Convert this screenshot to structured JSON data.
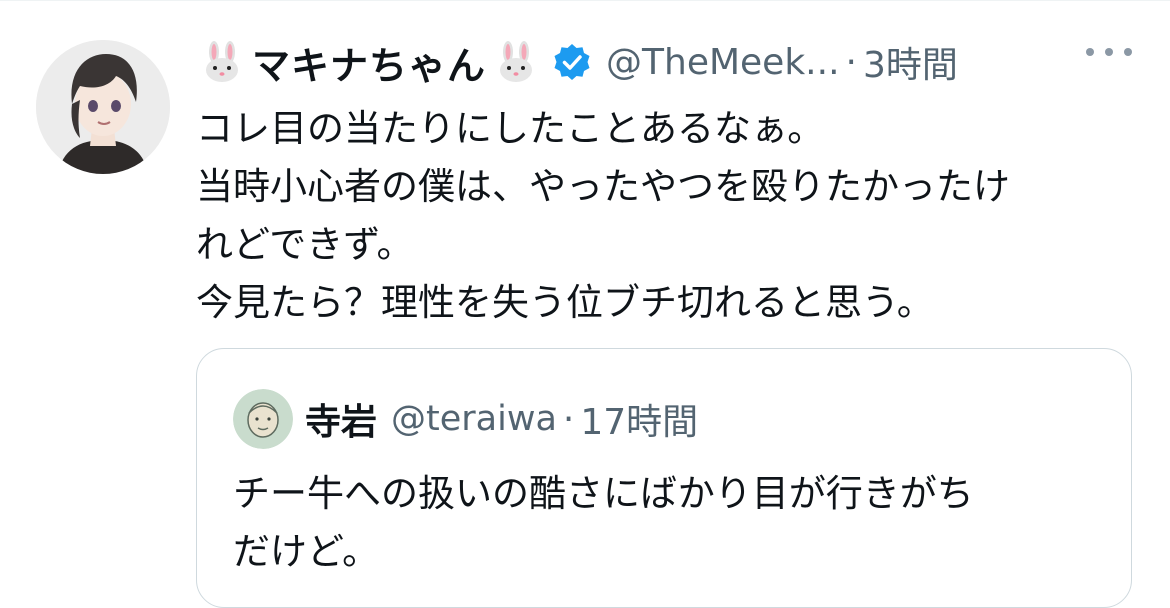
{
  "tweet": {
    "display_name": "マキナちゃん",
    "name_emoji_left": "rabbit-face-emoji",
    "name_emoji_right": "rabbit-face-emoji",
    "verified_icon": "verified-badge-icon",
    "handle": "@TheMeek...",
    "separator": "·",
    "time": "3時間",
    "more_icon": "more-horizontal-icon",
    "lines": [
      "コレ目の当たりにしたことあるなぁ。",
      "当時小心者の僕は、やったやつを殴りたかったけ",
      "れどできず。",
      "今見たら？理性を失う位ブチ切れると思う。"
    ]
  },
  "quoted": {
    "display_name": "寺岩",
    "handle": "@teraiwa",
    "separator": "·",
    "time": "17時間",
    "lines": [
      "チー牛への扱いの酷さにばかり目が行きがち",
      "だけど。"
    ]
  },
  "colors": {
    "text": "#0f1419",
    "secondary": "#536471",
    "verified": "#1d9bf0",
    "border": "#cfd9de"
  }
}
